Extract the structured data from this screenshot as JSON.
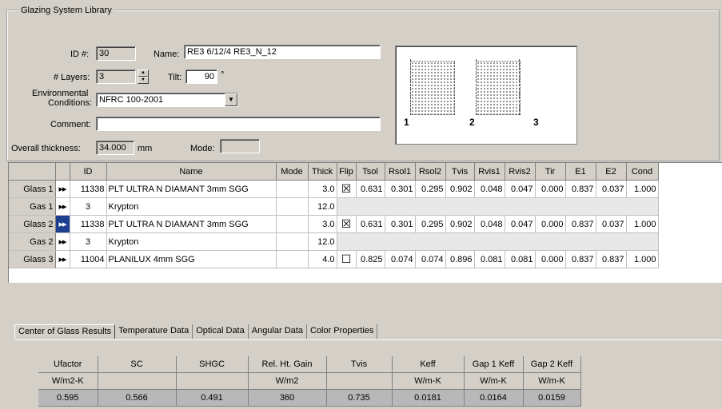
{
  "window": {
    "group_title": "Glazing System Library"
  },
  "form": {
    "id_label": "ID #:",
    "id_value": "30",
    "name_label": "Name:",
    "name_value": "RE3 6/12/4 RE3_N_12",
    "layers_label": "# Layers:",
    "layers_value": "3",
    "tilt_label": "Tilt:",
    "tilt_value": "90",
    "tilt_unit": "°",
    "env_label_1": "Environmental",
    "env_label_2": "Conditions:",
    "env_value": "NFRC 100-2001",
    "comment_label": "Comment:",
    "comment_value": "",
    "thickness_label": "Overall thickness:",
    "thickness_value": "34.000",
    "thickness_unit": "mm",
    "mode_label": "Mode:",
    "mode_value": ""
  },
  "preview": {
    "pane_numbers": [
      "1",
      "2",
      "3"
    ]
  },
  "layers_grid": {
    "headers": [
      "ID",
      "Name",
      "Mode",
      "Thick",
      "Flip",
      "Tsol",
      "Rsol1",
      "Rsol2",
      "Tvis",
      "Rvis1",
      "Rvis2",
      "Tir",
      "E1",
      "E2",
      "Cond"
    ],
    "rows": [
      {
        "label": "Glass 1",
        "arrows": "▸▸",
        "id": "11338",
        "name": "PLT ULTRA N DIAMANT 3mm SGG",
        "mode": "",
        "thick": "3.0",
        "flip": "☒",
        "tsol": "0.631",
        "rsol1": "0.301",
        "rsol2": "0.295",
        "tvis": "0.902",
        "rvis1": "0.048",
        "rvis2": "0.047",
        "tir": "0.000",
        "e1": "0.837",
        "e2": "0.037",
        "cond": "1.000"
      },
      {
        "label": "Gas 1",
        "arrows": "▸▸",
        "id": "3",
        "name": "Krypton",
        "mode": "",
        "thick": "12.0"
      },
      {
        "label": "Glass 2",
        "arrows": "▸▸",
        "id": "11338",
        "name": "PLT ULTRA N DIAMANT 3mm SGG",
        "mode": "",
        "thick": "3.0",
        "flip": "☒",
        "tsol": "0.631",
        "rsol1": "0.301",
        "rsol2": "0.295",
        "tvis": "0.902",
        "rvis1": "0.048",
        "rvis2": "0.047",
        "tir": "0.000",
        "e1": "0.837",
        "e2": "0.037",
        "cond": "1.000"
      },
      {
        "label": "Gas 2",
        "arrows": "▸▸",
        "id": "3",
        "name": "Krypton",
        "mode": "",
        "thick": "12.0"
      },
      {
        "label": "Glass 3",
        "arrows": "▸▸",
        "id": "11004",
        "name": "PLANILUX 4mm SGG",
        "mode": "",
        "thick": "4.0",
        "flip": "☐",
        "tsol": "0.825",
        "rsol1": "0.074",
        "rsol2": "0.074",
        "tvis": "0.896",
        "rvis1": "0.081",
        "rvis2": "0.081",
        "tir": "0.000",
        "e1": "0.837",
        "e2": "0.837",
        "cond": "1.000"
      }
    ]
  },
  "tabs": [
    "Center of Glass Results",
    "Temperature Data",
    "Optical Data",
    "Angular Data",
    "Color Properties"
  ],
  "results": {
    "headers": [
      "Ufactor",
      "SC",
      "SHGC",
      "Rel. Ht. Gain",
      "Tvis",
      "Keff",
      "Gap 1 Keff",
      "Gap 2 Keff"
    ],
    "units": [
      "W/m2-K",
      "",
      "",
      "W/m2",
      "",
      "W/m-K",
      "W/m-K",
      "W/m-K"
    ],
    "values": [
      "0.595",
      "0.566",
      "0.491",
      "360",
      "0.735",
      "0.0181",
      "0.0164",
      "0.0159"
    ]
  }
}
